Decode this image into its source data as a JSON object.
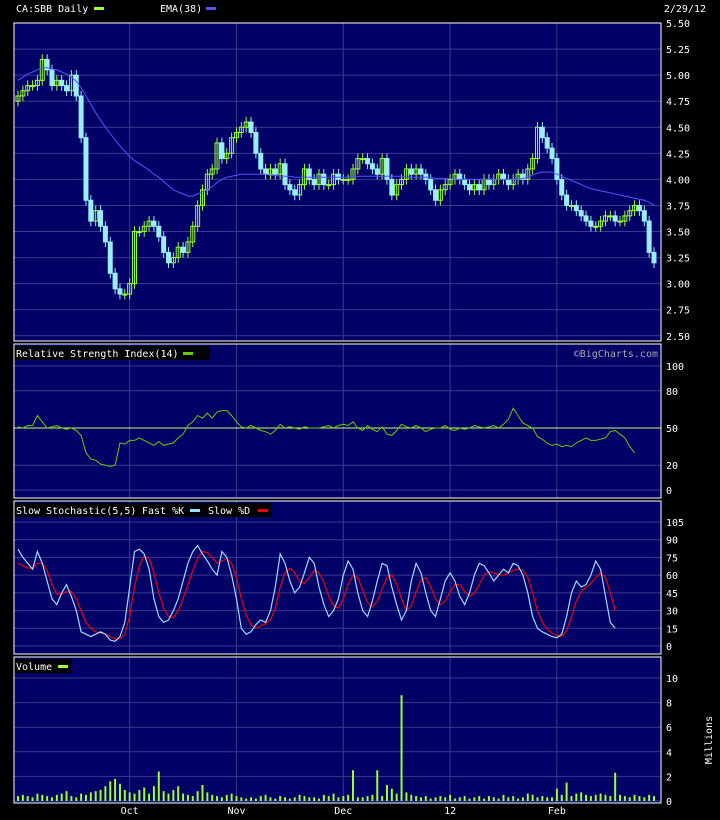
{
  "header": {
    "symbol_label": "CA:SBB Daily",
    "ema_label": "EMA(38)",
    "date": "2/29/12"
  },
  "watermark": "©BigCharts.com",
  "colors": {
    "background": "#000000",
    "panel": "#000066",
    "grid": "#3a3a90",
    "border": "#ffffff",
    "price_up": "#99ff33",
    "price_down": "#99eeff",
    "ema": "#5555ff",
    "rsi": "#66cc00",
    "rsi_ref": "#ccff66",
    "fast_k": "#99ddff",
    "slow_d": "#ee0000",
    "volume": "#99ff33",
    "text": "#ffffff"
  },
  "chart_data": [
    {
      "type": "candlestick",
      "name": "price",
      "legend": [
        {
          "label": "CA:SBB Daily",
          "color": "#99ff33"
        },
        {
          "label": "EMA(38)",
          "color": "#5555ff"
        }
      ],
      "y_ticks": [
        "5.50",
        "5.25",
        "5.00",
        "4.75",
        "4.50",
        "4.25",
        "4.00",
        "3.75",
        "3.50",
        "3.25",
        "3.00",
        "2.75",
        "2.50"
      ],
      "ylim": [
        2.45,
        5.5
      ],
      "x_ticks": [
        {
          "label": "Oct",
          "index": 23
        },
        {
          "label": "Nov",
          "index": 45
        },
        {
          "label": "Dec",
          "index": 67
        },
        {
          "label": "12",
          "index": 89
        },
        {
          "label": "Feb",
          "index": 111
        }
      ],
      "closes": [
        4.8,
        4.85,
        4.9,
        4.9,
        4.95,
        5.15,
        5.05,
        4.9,
        4.95,
        4.9,
        4.85,
        5.0,
        4.8,
        4.4,
        3.8,
        3.6,
        3.7,
        3.55,
        3.4,
        3.1,
        2.95,
        2.9,
        2.9,
        3.0,
        3.5,
        3.5,
        3.55,
        3.6,
        3.55,
        3.45,
        3.3,
        3.2,
        3.25,
        3.35,
        3.3,
        3.4,
        3.55,
        3.75,
        3.9,
        4.05,
        4.1,
        4.35,
        4.2,
        4.25,
        4.4,
        4.45,
        4.5,
        4.55,
        4.45,
        4.25,
        4.1,
        4.05,
        4.1,
        4.05,
        4.15,
        3.95,
        3.9,
        3.85,
        3.95,
        4.1,
        4.0,
        3.95,
        4.05,
        3.95,
        3.95,
        4.05,
        4.0,
        4.0,
        4.0,
        4.1,
        4.2,
        4.2,
        4.15,
        4.1,
        4.05,
        4.2,
        4.0,
        3.85,
        3.95,
        4.0,
        4.1,
        4.05,
        4.1,
        4.05,
        4.0,
        3.9,
        3.8,
        3.9,
        3.95,
        4.0,
        4.05,
        4.0,
        3.95,
        3.9,
        3.95,
        3.9,
        4.0,
        3.95,
        4.0,
        4.05,
        4.0,
        3.95,
        4.0,
        4.05,
        4.0,
        4.1,
        4.2,
        4.5,
        4.4,
        4.3,
        4.2,
        4.0,
        3.85,
        3.75,
        3.75,
        3.7,
        3.65,
        3.6,
        3.55,
        3.55,
        3.6,
        3.65,
        3.65,
        3.6,
        3.6,
        3.65,
        3.7,
        3.75,
        3.7,
        3.6,
        3.3,
        3.2
      ],
      "ema": [
        4.95,
        4.98,
        5.01,
        5.03,
        5.05,
        5.07,
        5.07,
        5.06,
        5.05,
        5.03,
        5.01,
        4.98,
        4.94,
        4.88,
        4.8,
        4.72,
        4.64,
        4.57,
        4.5,
        4.44,
        4.38,
        4.32,
        4.27,
        4.22,
        4.18,
        4.15,
        4.12,
        4.09,
        4.05,
        4.02,
        3.98,
        3.94,
        3.9,
        3.88,
        3.86,
        3.84,
        3.84,
        3.86,
        3.88,
        3.9,
        3.93,
        3.97,
        4.0,
        4.02,
        4.03,
        4.04,
        4.05,
        4.05,
        4.05,
        4.05,
        4.05,
        4.05,
        4.04,
        4.04,
        4.03,
        4.03,
        4.03,
        4.02,
        4.02,
        4.02,
        4.02,
        4.02,
        4.02,
        4.02,
        4.02,
        4.02,
        4.02,
        4.02,
        4.02,
        4.03,
        4.03,
        4.03,
        4.03,
        4.03,
        4.03,
        4.03,
        4.03,
        4.03,
        4.03,
        4.03,
        4.02,
        4.02,
        4.02,
        4.02,
        4.02,
        4.02,
        4.01,
        4.01,
        4.01,
        4.01,
        4.0,
        4.0,
        4.0,
        4.0,
        4.0,
        4.0,
        4.0,
        4.0,
        4.0,
        4.0,
        4.0,
        4.0,
        4.0,
        4.0,
        4.01,
        4.02,
        4.04,
        4.06,
        4.07,
        4.07,
        4.07,
        4.05,
        4.03,
        4.01,
        3.99,
        3.97,
        3.95,
        3.93,
        3.91,
        3.9,
        3.89,
        3.88,
        3.87,
        3.86,
        3.85,
        3.84,
        3.83,
        3.82,
        3.81,
        3.8,
        3.78,
        3.75
      ]
    },
    {
      "type": "line",
      "name": "rsi",
      "title": "Relative Strength Index(14)",
      "y_ticks": [
        "100",
        "80",
        "50",
        "20",
        "0"
      ],
      "ylim": [
        0,
        100
      ],
      "reference_line": 50,
      "values": [
        51,
        50,
        52,
        52,
        60,
        55,
        50,
        51,
        52,
        50,
        49,
        50,
        48,
        44,
        30,
        25,
        24,
        21,
        20,
        19,
        20,
        38,
        37,
        40,
        40,
        42,
        40,
        38,
        36,
        39,
        36,
        37,
        38,
        42,
        45,
        52,
        55,
        60,
        58,
        62,
        58,
        63,
        64,
        64,
        60,
        55,
        51,
        50,
        52,
        50,
        48,
        47,
        45,
        48,
        53,
        50,
        51,
        50,
        49,
        51,
        50,
        50,
        50,
        51,
        52,
        50,
        52,
        53,
        52,
        55,
        50,
        48,
        52,
        49,
        47,
        51,
        45,
        44,
        48,
        53,
        51,
        50,
        52,
        50,
        47,
        49,
        50,
        50,
        52,
        49,
        48,
        50,
        49,
        50,
        52,
        51,
        50,
        51,
        52,
        50,
        53,
        57,
        66,
        60,
        54,
        52,
        50,
        43,
        41,
        38,
        36,
        37,
        35,
        36,
        35,
        38,
        40,
        42,
        40,
        40,
        41,
        42,
        47,
        48,
        45,
        42,
        35,
        30
      ]
    },
    {
      "type": "line",
      "name": "stochastic",
      "title": "Slow Stochastic(5,5)",
      "legend": [
        {
          "label": "Fast %K",
          "color": "#99ddff"
        },
        {
          "label": "Slow %D",
          "color": "#ee0000"
        }
      ],
      "y_ticks": [
        "105",
        "90",
        "75",
        "60",
        "45",
        "30",
        "15",
        "0"
      ],
      "ylim": [
        0,
        105
      ],
      "series": [
        {
          "name": "Fast %K",
          "values": [
            82,
            75,
            70,
            65,
            80,
            70,
            55,
            40,
            35,
            45,
            52,
            42,
            30,
            12,
            10,
            8,
            10,
            12,
            10,
            5,
            4,
            8,
            20,
            50,
            80,
            82,
            78,
            65,
            40,
            25,
            20,
            22,
            30,
            40,
            55,
            70,
            80,
            85,
            78,
            72,
            65,
            60,
            80,
            75,
            60,
            40,
            15,
            10,
            12,
            18,
            22,
            20,
            30,
            50,
            78,
            70,
            55,
            45,
            50,
            62,
            75,
            70,
            50,
            35,
            25,
            30,
            40,
            60,
            72,
            65,
            45,
            30,
            25,
            38,
            55,
            70,
            68,
            50,
            35,
            22,
            30,
            55,
            70,
            62,
            45,
            30,
            25,
            40,
            55,
            62,
            55,
            42,
            35,
            45,
            60,
            70,
            68,
            62,
            55,
            60,
            65,
            62,
            70,
            68,
            60,
            45,
            25,
            15,
            12,
            10,
            8,
            7,
            10,
            25,
            45,
            55,
            50,
            52,
            60,
            72,
            65,
            42,
            20,
            15
          ],
          "color": "#99ddff"
        },
        {
          "name": "Slow %D",
          "values": [
            70,
            68,
            66,
            66,
            70,
            70,
            64,
            52,
            44,
            44,
            46,
            46,
            40,
            30,
            20,
            15,
            12,
            11,
            10,
            8,
            6,
            6,
            10,
            25,
            50,
            68,
            76,
            74,
            62,
            45,
            32,
            25,
            24,
            30,
            40,
            52,
            64,
            74,
            80,
            79,
            75,
            70,
            72,
            74,
            70,
            58,
            40,
            26,
            18,
            15,
            17,
            19,
            22,
            32,
            50,
            62,
            66,
            62,
            55,
            53,
            58,
            64,
            62,
            54,
            42,
            34,
            32,
            40,
            52,
            60,
            58,
            47,
            37,
            33,
            38,
            48,
            58,
            60,
            52,
            40,
            30,
            34,
            46,
            56,
            58,
            50,
            40,
            35,
            38,
            46,
            52,
            52,
            46,
            42,
            45,
            52,
            60,
            63,
            62,
            60,
            60,
            62,
            64,
            65,
            64,
            58,
            45,
            30,
            20,
            14,
            11,
            9,
            8,
            13,
            25,
            38,
            46,
            50,
            53,
            58,
            62,
            58,
            45,
            30
          ],
          "color": "#ee0000"
        }
      ]
    },
    {
      "type": "bar",
      "name": "volume",
      "title": "Volume",
      "ylabel": "Millions",
      "y_ticks": [
        "10",
        "8",
        "6",
        "4",
        "2",
        "0"
      ],
      "ylim": [
        0,
        10
      ],
      "values": [
        0.4,
        0.5,
        0.4,
        0.3,
        0.6,
        0.5,
        0.4,
        0.3,
        0.5,
        0.6,
        0.8,
        0.4,
        0.3,
        0.6,
        0.5,
        0.7,
        0.8,
        0.9,
        1.2,
        1.6,
        1.8,
        1.4,
        0.9,
        0.7,
        0.6,
        0.9,
        1.1,
        0.6,
        1.2,
        2.4,
        0.8,
        0.6,
        0.9,
        1.2,
        0.6,
        0.5,
        0.4,
        0.8,
        1.3,
        0.7,
        0.5,
        0.4,
        0.3,
        0.5,
        0.6,
        0.4,
        0.3,
        0.2,
        0.3,
        0.2,
        0.4,
        0.5,
        0.3,
        0.2,
        0.4,
        0.3,
        0.2,
        0.3,
        0.5,
        0.4,
        0.3,
        0.3,
        0.2,
        0.5,
        0.4,
        0.6,
        0.3,
        0.4,
        0.5,
        2.5,
        0.3,
        0.3,
        0.4,
        0.5,
        2.5,
        0.4,
        1.3,
        1.0,
        0.6,
        8.6,
        0.7,
        0.5,
        0.4,
        0.3,
        0.4,
        0.2,
        0.3,
        0.4,
        0.3,
        0.5,
        0.2,
        0.3,
        0.4,
        0.2,
        0.3,
        0.4,
        0.2,
        0.4,
        0.3,
        0.2,
        0.5,
        0.3,
        0.4,
        0.2,
        0.3,
        0.6,
        0.5,
        0.3,
        0.4,
        0.3,
        0.3,
        1.0,
        0.5,
        1.5,
        0.4,
        0.6,
        0.7,
        0.5,
        0.4,
        0.5,
        0.6,
        0.5,
        0.4,
        2.3,
        0.5,
        0.4,
        0.3,
        0.5,
        0.4,
        0.3,
        0.5,
        0.4
      ]
    }
  ]
}
